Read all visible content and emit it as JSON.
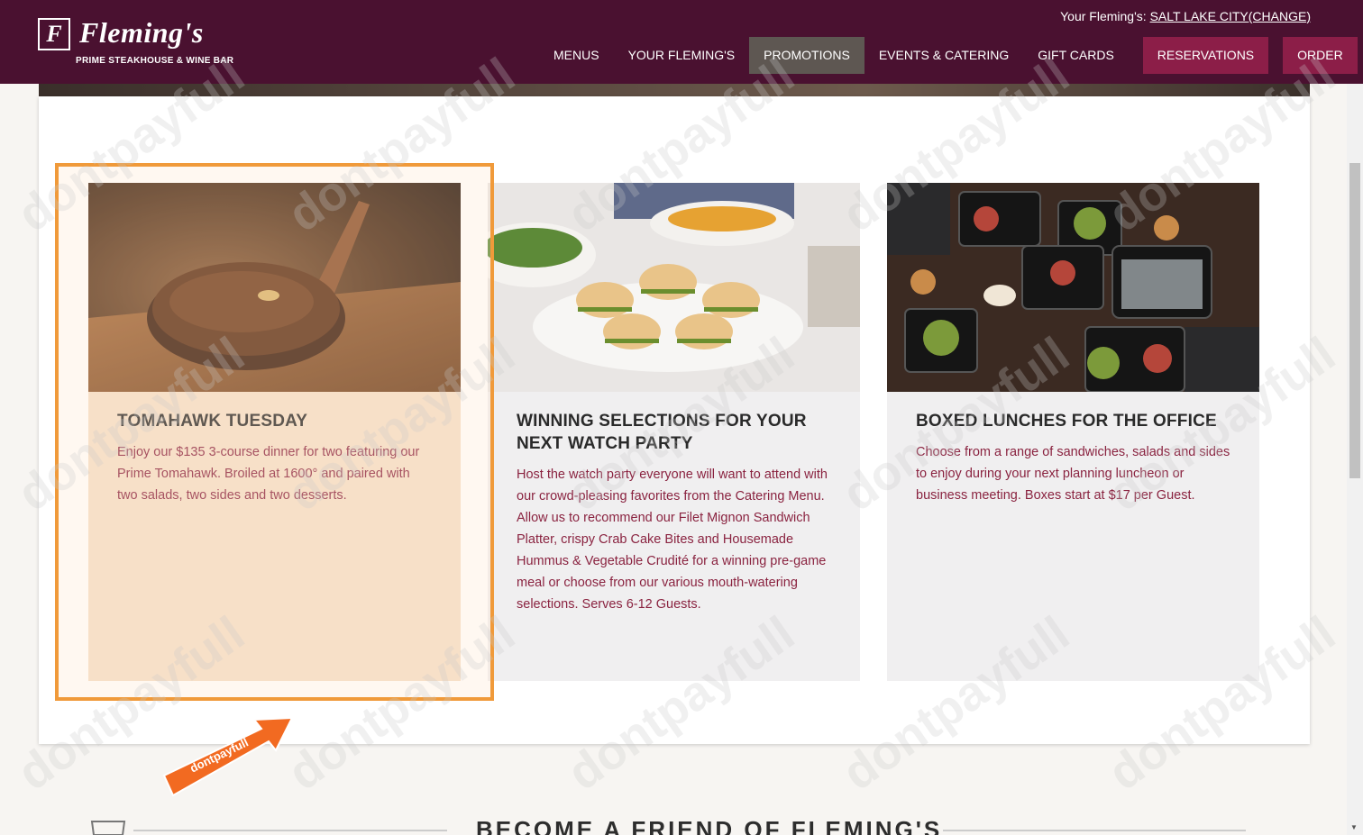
{
  "header": {
    "logo_letter": "F",
    "logo_name": "Fleming's",
    "logo_tagline": "PRIME STEAKHOUSE & WINE BAR",
    "location_prefix": "Your Fleming's:",
    "location_city": "SALT LAKE CITY",
    "location_change": "(CHANGE)",
    "nav": [
      {
        "label": "MENUS"
      },
      {
        "label": "YOUR FLEMING'S"
      },
      {
        "label": "PROMOTIONS",
        "active": true
      },
      {
        "label": "EVENTS & CATERING"
      },
      {
        "label": "GIFT CARDS"
      },
      {
        "label": "RESERVATIONS"
      },
      {
        "label": "ORDER"
      }
    ],
    "menu_icon": "hamburger-icon"
  },
  "cards": [
    {
      "title": "TOMAHAWK TUESDAY",
      "text": "Enjoy our $135 3-course dinner for two featuring our Prime Tomahawk. Broiled at 1600° and paired with two salads, two sides and two desserts."
    },
    {
      "title": "WINNING SELECTIONS FOR YOUR NEXT WATCH PARTY",
      "text": "Host the watch party everyone will want to attend with our crowd-pleasing favorites from the Catering Menu. Allow us to recommend our Filet Mignon Sandwich Platter, crispy Crab Cake Bites and Housemade Hummus & Vegetable Crudité for a winning pre-game meal or choose from our various mouth-watering selections. Serves 6-12 Guests."
    },
    {
      "title": "BOXED LUNCHES FOR THE OFFICE",
      "text": "Choose from a range of sandwiches, salads and sides to enjoy during your next planning luncheon or business meeting. Boxes start at $17 per Guest."
    }
  ],
  "friend": {
    "title": "BECOME A FRIEND OF FLEMING'S"
  },
  "watermark": {
    "text": "dontpayfull",
    "badge": "dontpayfull"
  },
  "colors": {
    "header_bg": "#4a1130",
    "accent": "#8c1e48",
    "highlight": "#f09a3a",
    "body_text": "#8a2340"
  }
}
